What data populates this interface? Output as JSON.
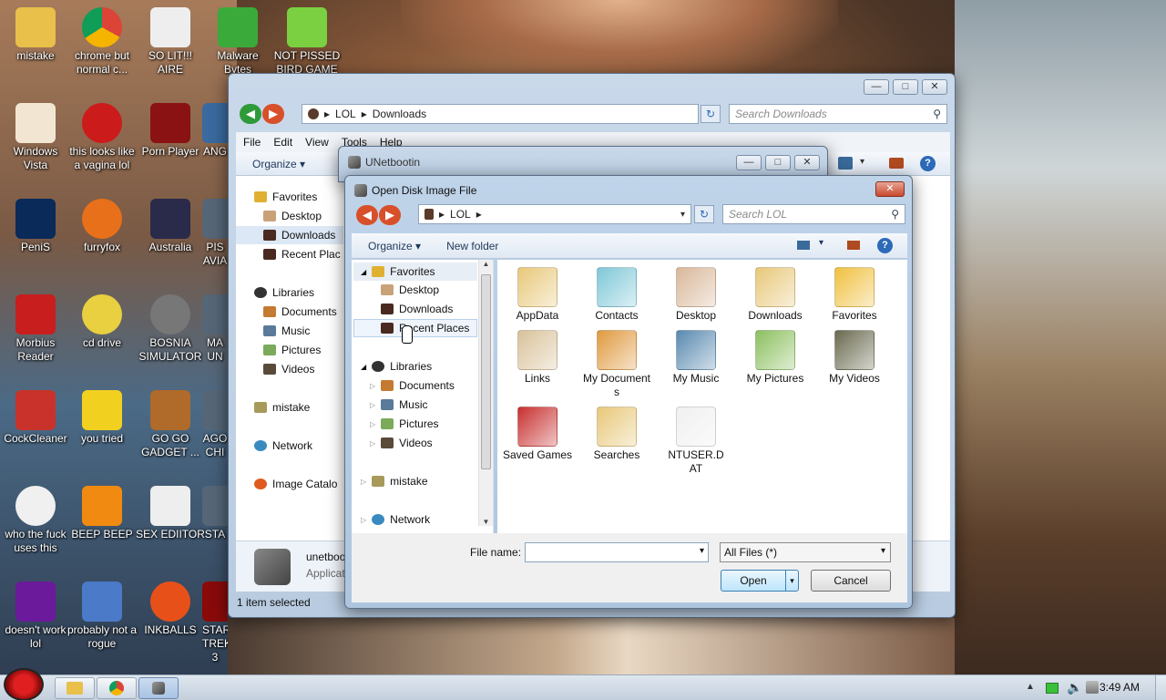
{
  "desktop": {
    "icons": [
      {
        "label": "mistake",
        "icon": "folder-icon"
      },
      {
        "label": "chrome but normal c...",
        "icon": "chrome-icon"
      },
      {
        "label": "SO LIT!!! AIRE",
        "icon": "cards-icon"
      },
      {
        "label": "Malware Bytes",
        "icon": "shield-icon"
      },
      {
        "label": "NOT PISSED BIRD GAME",
        "icon": "pig-icon"
      },
      {
        "label": "Windows Vista",
        "icon": "egg-icon"
      },
      {
        "label": "this looks like a vagina lol",
        "icon": "opera-icon"
      },
      {
        "label": "Porn Player",
        "icon": "flash-icon"
      },
      {
        "label": "ANG",
        "icon": "bird-icon"
      },
      {
        "label": "PeniS",
        "icon": "photoshop-icon"
      },
      {
        "label": "furryfox",
        "icon": "firefox-icon"
      },
      {
        "label": "Australia",
        "icon": "spider-icon"
      },
      {
        "label": "PIS AVIA",
        "icon": "app-icon"
      },
      {
        "label": "Morbius Reader",
        "icon": "pdf-icon"
      },
      {
        "label": "cd drive",
        "icon": "cd-icon"
      },
      {
        "label": "BOSNIA SIMULATOR",
        "icon": "mine-icon"
      },
      {
        "label": "MA UN",
        "icon": "app-icon"
      },
      {
        "label": "CockCleaner",
        "icon": "cleaner-icon"
      },
      {
        "label": "you tried",
        "icon": "star-icon"
      },
      {
        "label": "GO GO GADGET ...",
        "icon": "briefcase-icon"
      },
      {
        "label": "AGO CHI",
        "icon": "app-icon"
      },
      {
        "label": "who the fuck uses this",
        "icon": "bolt-icon"
      },
      {
        "label": "BEEP BEEP",
        "icon": "vlc-icon"
      },
      {
        "label": "SEX EDIITOR",
        "icon": "hxd-icon"
      },
      {
        "label": "STA",
        "icon": "app-icon"
      },
      {
        "label": "doesn't work lol",
        "icon": "yahoo-icon"
      },
      {
        "label": "probably not a rogue",
        "icon": "gear-monitor-icon"
      },
      {
        "label": "INKBALLS",
        "icon": "ball-icon"
      },
      {
        "label": "STAR TREK 3",
        "icon": "startrek-icon"
      }
    ]
  },
  "explorer": {
    "address_root": "LOL",
    "address_current": "Downloads",
    "search_placeholder": "Search Downloads",
    "menu": [
      "File",
      "Edit",
      "View",
      "Tools",
      "Help"
    ],
    "organize": "Organize",
    "nav": {
      "favorites": "Favorites",
      "desktop": "Desktop",
      "downloads": "Downloads",
      "recent": "Recent Plac",
      "libraries": "Libraries",
      "documents": "Documents",
      "music": "Music",
      "pictures": "Pictures",
      "videos": "Videos",
      "mistake": "mistake",
      "network": "Network",
      "image_catalog": "Image Catalo"
    },
    "details_name": "unetboo",
    "details_type": "Applicat",
    "status": "1 item selected"
  },
  "unetbootin": {
    "title": "UNetbootin"
  },
  "dialog": {
    "title": "Open Disk Image File",
    "address": "LOL",
    "search_placeholder": "Search LOL",
    "organize": "Organize",
    "new_folder": "New folder",
    "nav": {
      "favorites": "Favorites",
      "desktop": "Desktop",
      "downloads": "Downloads",
      "recent": "Recent Places",
      "libraries": "Libraries",
      "documents": "Documents",
      "music": "Music",
      "pictures": "Pictures",
      "videos": "Videos",
      "mistake": "mistake",
      "network": "Network"
    },
    "files": [
      {
        "label": "AppData",
        "icon": "folder-icon",
        "color": "#e8c87a"
      },
      {
        "label": "Contacts",
        "icon": "contacts-folder-icon",
        "color": "#7fc8d8"
      },
      {
        "label": "Desktop",
        "icon": "desktop-folder-icon",
        "color": "#d9b89a"
      },
      {
        "label": "Downloads",
        "icon": "downloads-folder-icon",
        "color": "#e8c87a"
      },
      {
        "label": "Favorites",
        "icon": "favorites-folder-icon",
        "color": "#f0c040"
      },
      {
        "label": "Links",
        "icon": "links-folder-icon",
        "color": "#d9c29a"
      },
      {
        "label": "My Documents",
        "icon": "documents-folder-icon",
        "color": "#e09a40"
      },
      {
        "label": "My Music",
        "icon": "music-folder-icon",
        "color": "#5a8ab0"
      },
      {
        "label": "My Pictures",
        "icon": "pictures-folder-icon",
        "color": "#8cc060"
      },
      {
        "label": "My Videos",
        "icon": "videos-folder-icon",
        "color": "#6a6a50"
      },
      {
        "label": "Saved Games",
        "icon": "games-folder-icon",
        "color": "#c83030"
      },
      {
        "label": "Searches",
        "icon": "searches-folder-icon",
        "color": "#e8c87a"
      },
      {
        "label": "NTUSER.DAT",
        "icon": "file-icon",
        "color": "#f0f0f0"
      }
    ],
    "file_name_label": "File name:",
    "file_name_value": "",
    "file_type": "All Files  (*)",
    "open": "Open",
    "cancel": "Cancel"
  },
  "taskbar": {
    "clock": "3:49 AM"
  }
}
